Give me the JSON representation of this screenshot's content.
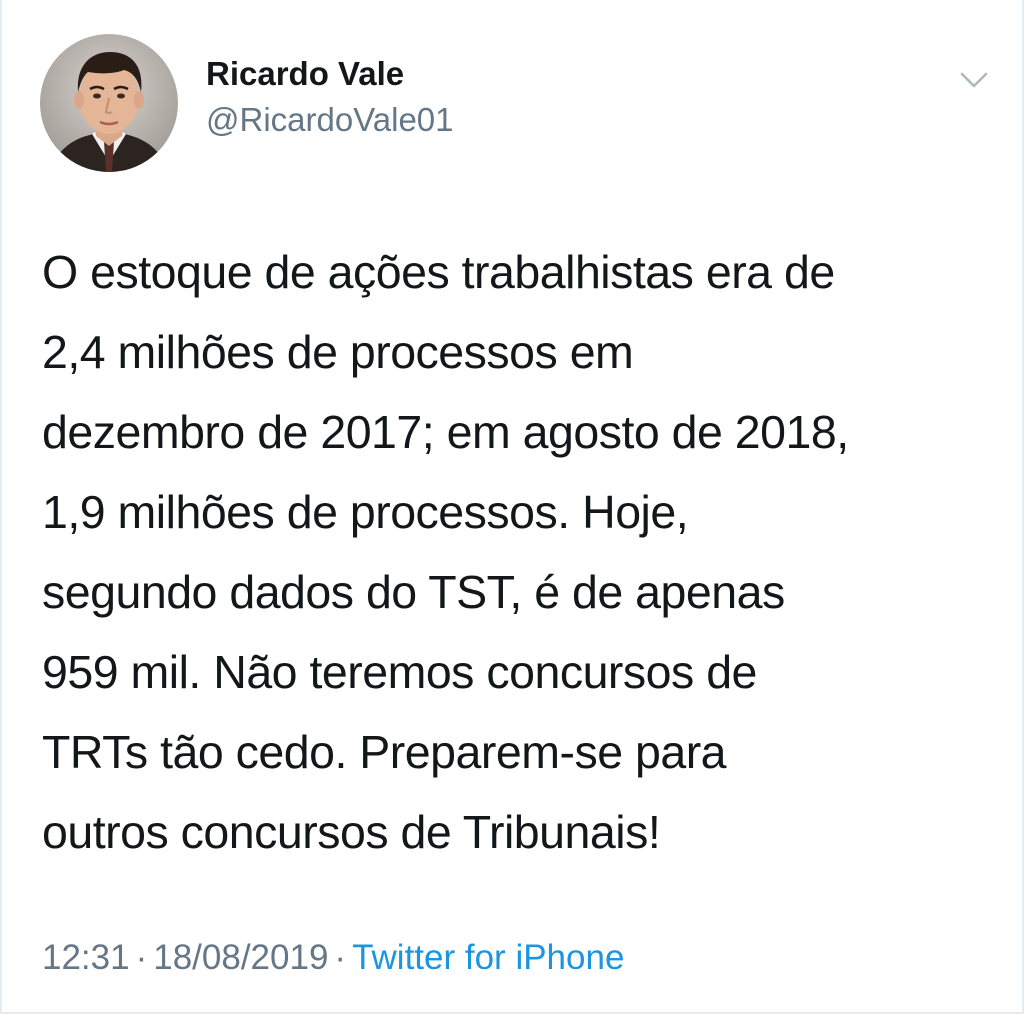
{
  "author": {
    "display_name": "Ricardo Vale",
    "handle": "@RicardoVale01"
  },
  "icons": {
    "menu": "chevron-down-icon",
    "avatar": "profile-photo"
  },
  "tweet": {
    "lines": [
      "O estoque de ações trabalhistas era de",
      "2,4 milhões de processos em",
      "dezembro de 2017; em agosto de 2018,",
      "1,9 milhões de processos. Hoje,",
      "segundo dados do TST, é de apenas",
      "959 mil. Não teremos concursos de",
      "TRTs tão cedo. Preparem-se para",
      "outros concursos de Tribunais!"
    ]
  },
  "meta": {
    "time": "12:31",
    "separator": "·",
    "date": "18/08/2019",
    "source": "Twitter for iPhone"
  },
  "colors": {
    "text": "#14171a",
    "secondary": "#657786",
    "link": "#1b95e0",
    "border": "#e6ecf0"
  }
}
